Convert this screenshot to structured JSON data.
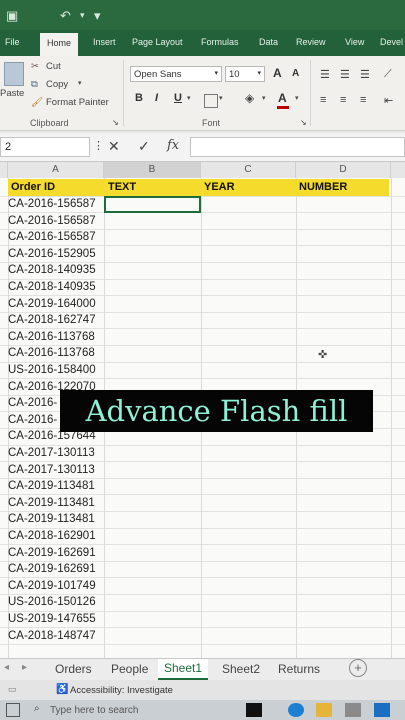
{
  "title_bar": {
    "save_icon": "save-icon",
    "undo_icon": "undo-icon",
    "redo_icon": "redo-icon"
  },
  "tabs": [
    "File",
    "Home",
    "Insert",
    "Page Layout",
    "Formulas",
    "Data",
    "Review",
    "View",
    "Devel"
  ],
  "active_tab": "Home",
  "ribbon": {
    "paste": "Paste",
    "cut": "Cut",
    "copy": "Copy",
    "format_painter": "Format Painter",
    "clipboard_group": "Clipboard",
    "font_name": "Open Sans",
    "font_size": "10",
    "font_group": "Font",
    "bold": "B",
    "italic": "I",
    "underline": "U",
    "grow_font": "A",
    "shrink_font": "A",
    "font_color": "A",
    "font_color_value": "#c00000"
  },
  "formula_bar": {
    "name_box": "2",
    "cancel": "✕",
    "enter": "✓",
    "fx": "fx",
    "value": ""
  },
  "columns": [
    "A",
    "B",
    "C",
    "D"
  ],
  "header_row": {
    "order_id": "Order ID",
    "text": "TEXT",
    "year": "YEAR",
    "number": "NUMBER"
  },
  "order_ids": [
    "CA-2016-156587",
    "CA-2016-156587",
    "CA-2016-156587",
    "CA-2016-152905",
    "CA-2018-140935",
    "CA-2018-140935",
    "CA-2019-164000",
    "CA-2018-162747",
    "CA-2016-113768",
    "CA-2016-113768",
    "US-2016-158400",
    "CA-2016-122070",
    "CA-2016-",
    "CA-2016-",
    "CA-2016-157644",
    "CA-2017-130113",
    "CA-2017-130113",
    "CA-2019-113481",
    "CA-2019-113481",
    "CA-2019-113481",
    "CA-2018-162901",
    "CA-2019-162691",
    "CA-2019-162691",
    "CA-2019-101749",
    "US-2016-150126",
    "US-2019-147655",
    "CA-2018-148747"
  ],
  "overlay_caption": "Advance Flash fill",
  "sheet_tabs": [
    "Orders",
    "People",
    "Sheet1",
    "Sheet2",
    "Returns"
  ],
  "active_sheet": "Sheet1",
  "status": {
    "accessibility": "Accessibility: Investigate"
  },
  "taskbar": {
    "search_placeholder": "Type here to search"
  },
  "colors": {
    "title_green": "#2b6a3f",
    "header_yellow": "#f5db2b",
    "selection_green": "#1e6b3c",
    "caption_text": "#8ff0d6"
  }
}
